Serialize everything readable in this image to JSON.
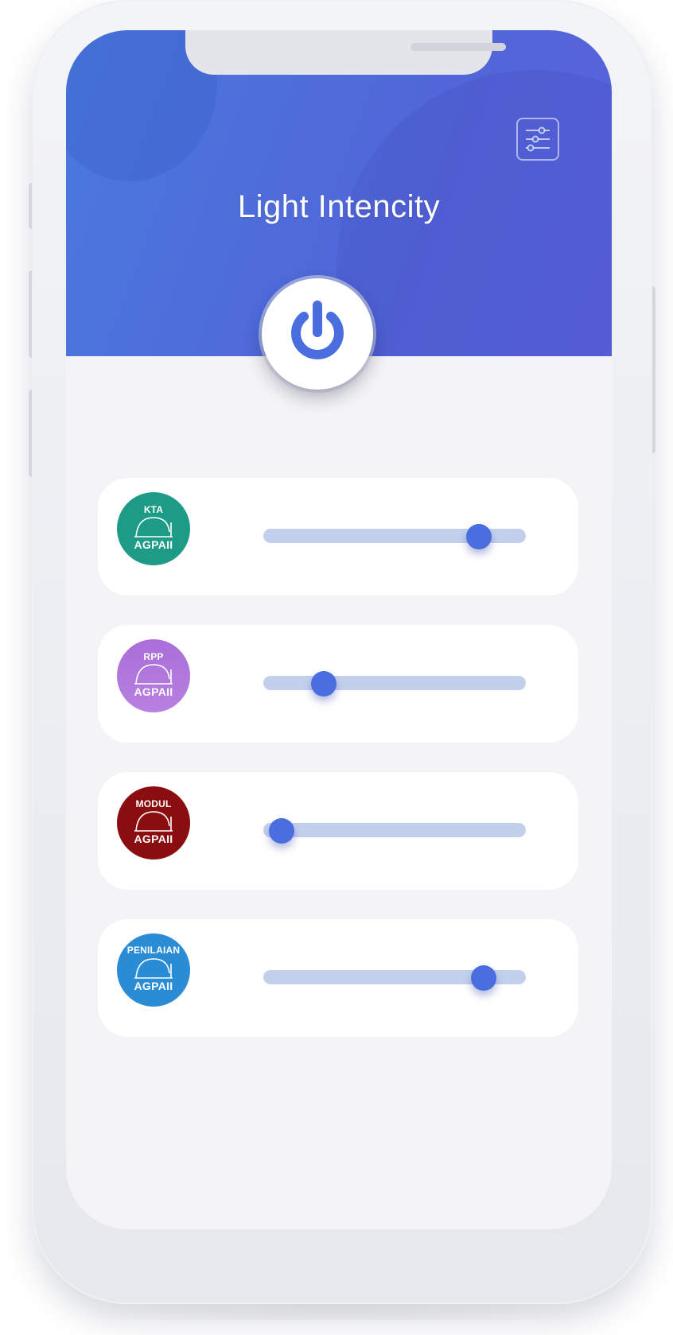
{
  "header": {
    "title": "Light Intencity",
    "settings_icon": "sliders-settings-icon",
    "power_icon": "power-icon",
    "gradient_start": "#4a79de",
    "gradient_end": "#5a62db"
  },
  "controls": [
    {
      "badge_top": "KTA",
      "badge_bottom": "AGPAII",
      "badge_color": "#1e9b86",
      "level": 0.82
    },
    {
      "badge_top": "RPP",
      "badge_bottom": "AGPAII",
      "badge_color": "#b07ad9",
      "level": 0.23
    },
    {
      "badge_top": "MODUL",
      "badge_bottom": "AGPAII",
      "badge_color": "#8a0d10",
      "level": 0.07
    },
    {
      "badge_top": "PENILAIAN",
      "badge_bottom": "AGPAII",
      "badge_color": "#2b8cd6",
      "level": 0.84
    }
  ],
  "accent_color": "#4a6de0",
  "track_color": "#c3d0ec"
}
